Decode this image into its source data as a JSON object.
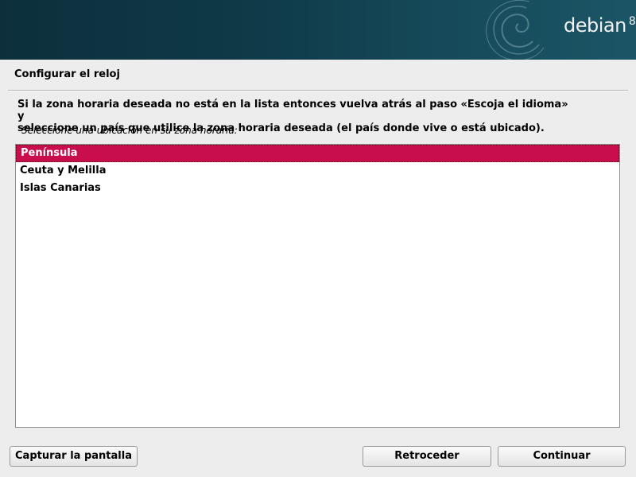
{
  "banner": {
    "brand": "debian",
    "version": "8"
  },
  "page": {
    "title": "Configurar el reloj",
    "description_line1": "Si la zona horaria deseada no está en la lista entonces vuelva atrás al paso «Escoja el idioma» y",
    "description_line2": "seleccione un país que utilice la zona horaria deseada (el país donde vive o está ubicado).",
    "prompt": "Seleccione una ubicación en su zona horaria:"
  },
  "list": {
    "items": [
      {
        "label": "Península",
        "selected": true
      },
      {
        "label": "Ceuta y Melilla",
        "selected": false
      },
      {
        "label": "Islas Canarias",
        "selected": false
      }
    ]
  },
  "buttons": {
    "screenshot": "Capturar la pantalla",
    "back": "Retroceder",
    "continue": "Continuar"
  },
  "colors": {
    "selection": "#c90e4d",
    "banner": "#0f3a48"
  }
}
